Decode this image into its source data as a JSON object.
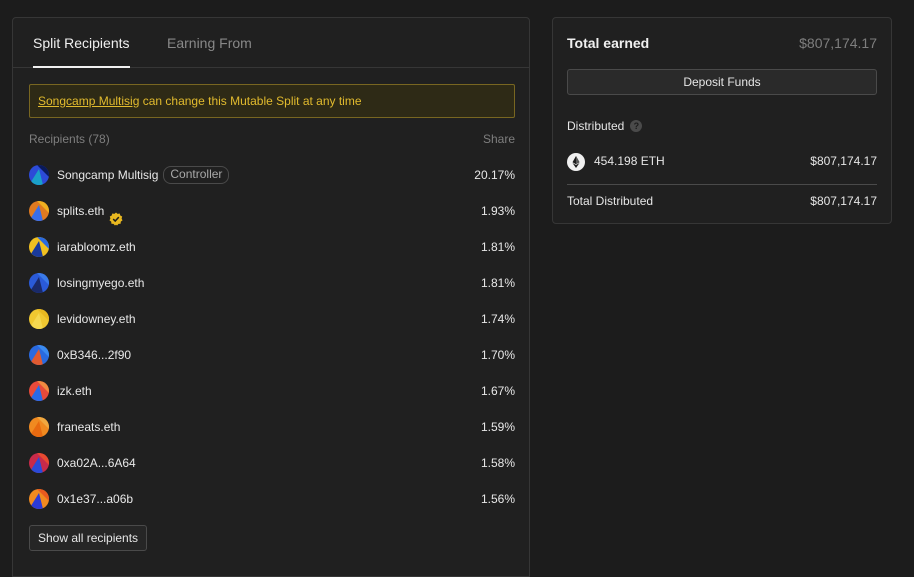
{
  "tabs": [
    {
      "label": "Split Recipients",
      "active": true
    },
    {
      "label": "Earning From",
      "active": false
    }
  ],
  "notice": {
    "link_text": "Songcamp Multisig",
    "text": " can change this Mutable Split at any time"
  },
  "recipients_header": {
    "label": "Recipients (78)",
    "share_label": "Share"
  },
  "recipients": [
    {
      "name": "Songcamp Multisig",
      "badge": "Controller",
      "share": "20.17%",
      "avatar_colors": [
        "#2c4bd8",
        "#1aa0c8",
        "#0a1a5a"
      ]
    },
    {
      "name": "splits.eth",
      "verified": true,
      "share": "1.93%",
      "avatar_colors": [
        "#e07a20",
        "#3a6ee8",
        "#f0b020"
      ]
    },
    {
      "name": "iarabloomz.eth",
      "share": "1.81%",
      "avatar_colors": [
        "#f0c020",
        "#1a3a9a",
        "#2a6ae0"
      ]
    },
    {
      "name": "losingmyego.eth",
      "share": "1.81%",
      "avatar_colors": [
        "#2a5ad8",
        "#1a2a6a",
        "#3a7ae8"
      ]
    },
    {
      "name": "levidowney.eth",
      "share": "1.74%",
      "avatar_colors": [
        "#f0c830",
        "#f5d850",
        "#e8b820"
      ]
    },
    {
      "name": "0xB346...2f90",
      "share": "1.70%",
      "avatar_colors": [
        "#2a6ae0",
        "#e05a30",
        "#3a8af0"
      ]
    },
    {
      "name": "izk.eth",
      "share": "1.67%",
      "avatar_colors": [
        "#e84a3a",
        "#2a6ae8",
        "#f08a40"
      ]
    },
    {
      "name": "franeats.eth",
      "share": "1.59%",
      "avatar_colors": [
        "#f08a20",
        "#e86a10",
        "#f0a840"
      ]
    },
    {
      "name": "0xa02A...6A64",
      "share": "1.58%",
      "avatar_colors": [
        "#c82a4a",
        "#2a4ad8",
        "#e84a30"
      ]
    },
    {
      "name": "0x1e37...a06b",
      "share": "1.56%",
      "avatar_colors": [
        "#f08a20",
        "#2a3ad8",
        "#e85a20"
      ]
    }
  ],
  "show_all_label": "Show all recipients",
  "summary": {
    "total_label": "Total earned",
    "total_value": "$807,174.17",
    "deposit_label": "Deposit Funds",
    "distributed_label": "Distributed",
    "help_icon": "question-icon",
    "eth_amount": "454.198 ETH",
    "eth_usd": "$807,174.17",
    "total_distributed_label": "Total Distributed",
    "total_distributed_value": "$807,174.17"
  },
  "colors": {
    "background": "#1c1c1c",
    "notice_text": "#e2bb2e",
    "notice_border": "#786621",
    "verified": "#e8b820"
  }
}
